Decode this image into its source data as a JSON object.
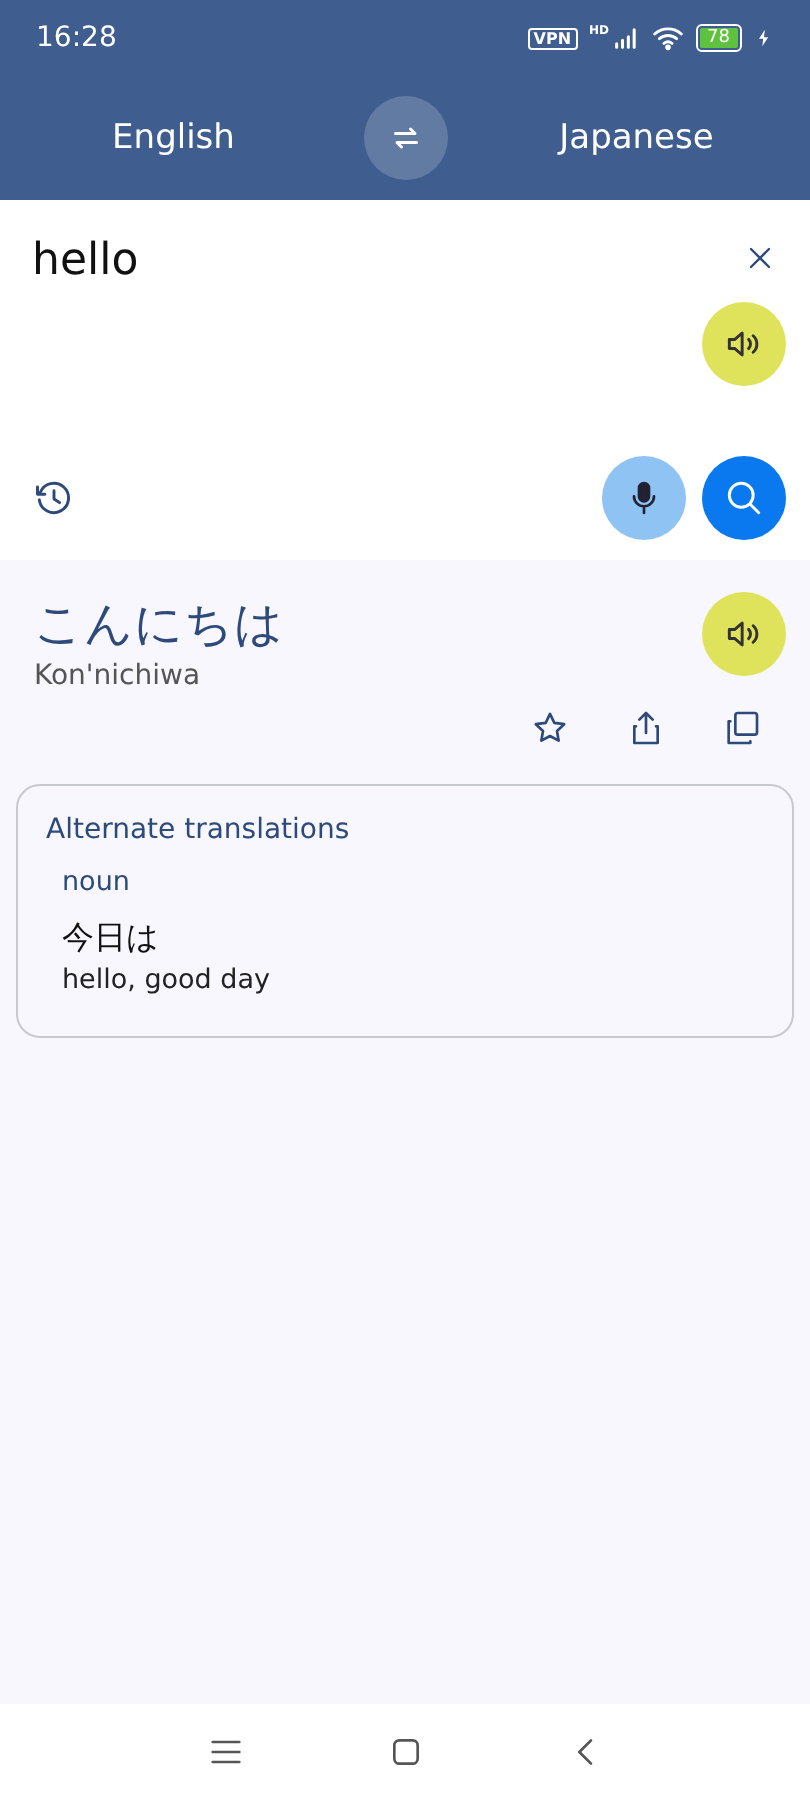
{
  "status_bar": {
    "time": "16:28",
    "vpn": "VPN",
    "network": "HD",
    "battery": "78"
  },
  "languages": {
    "source": "English",
    "target": "Japanese"
  },
  "input": {
    "value": "hello"
  },
  "result": {
    "text": "こんにちは",
    "romanization": "Kon'nichiwa"
  },
  "alternates": {
    "title": "Alternate translations",
    "groups": [
      {
        "part_of_speech": "noun",
        "entries": [
          {
            "term": "今日は",
            "meaning": "hello, good day"
          }
        ]
      }
    ]
  }
}
